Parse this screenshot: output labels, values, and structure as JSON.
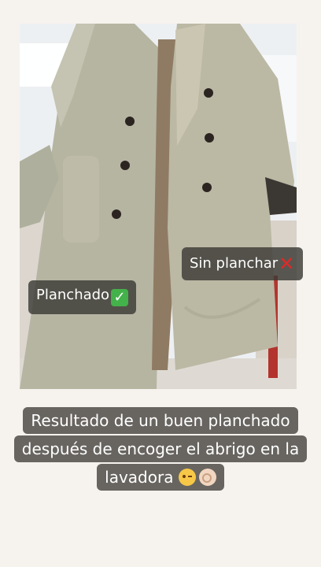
{
  "labels": {
    "left": "Planchado",
    "right": "Sin planchar"
  },
  "icons": {
    "left_mark": "white-check-mark-icon",
    "right_mark": "red-cross-icon",
    "wink": "winking-face-icon",
    "ok": "ok-hand-icon"
  },
  "caption": {
    "line1": "Resultado de un buen planchado",
    "line2": "después de encoger el abrigo en la",
    "line3": "lavadora"
  },
  "colors": {
    "tag_bg": "#3c3a36",
    "check_green": "#44b24a",
    "cross_red": "#e02929",
    "coat": "#b7b7a6"
  }
}
